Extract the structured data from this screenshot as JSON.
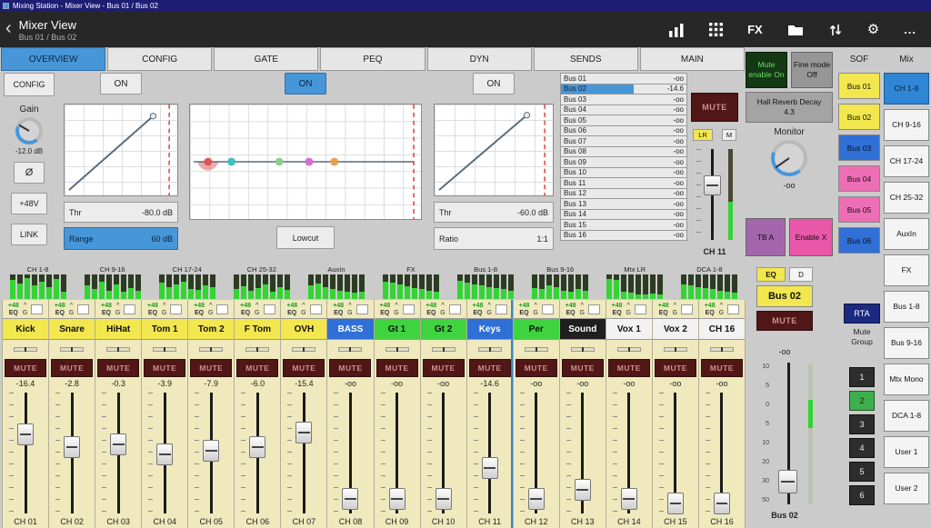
{
  "titlebar": {
    "text": "Mixing Station - Mixer View - Bus 01 / Bus 02"
  },
  "appbar": {
    "back": "‹",
    "title": "Mixer View",
    "subtitle": "Bus 01 / Bus 02",
    "fx": "FX",
    "gear": "⚙",
    "overflow": "..."
  },
  "tabs": [
    {
      "label": "OVERVIEW",
      "active": true
    },
    {
      "label": "CONFIG",
      "active": false
    },
    {
      "label": "GATE",
      "active": false
    },
    {
      "label": "PEQ",
      "active": false
    },
    {
      "label": "DYN",
      "active": false
    },
    {
      "label": "SENDS",
      "active": false
    },
    {
      "label": "MAIN",
      "active": false
    }
  ],
  "config": {
    "button": "CONFIG",
    "gain_label": "Gain",
    "gain_value": "-12.0 dB",
    "phase": "Ø",
    "phantom": "+48V",
    "link": "LINK"
  },
  "gate": {
    "on": "ON",
    "thr_label": "Thr",
    "thr_value": "-80.0 dB",
    "range_label": "Range",
    "range_value": "60 dB"
  },
  "peq": {
    "on": "ON",
    "lowcut": "Lowcut",
    "band_colors": [
      "#e05555",
      "#3fbfbf",
      "#8fcf8f",
      "#d36fd3",
      "#e8a050"
    ]
  },
  "dyn": {
    "on": "ON",
    "thr_label": "Thr",
    "thr_value": "-60.0 dB",
    "ratio_label": "Ratio",
    "ratio_value": "1:1"
  },
  "sends": {
    "rows": [
      {
        "name": "Bus 01",
        "value": "-oo",
        "fill_pct": 0
      },
      {
        "name": "Bus 02",
        "value": "-14.6",
        "fill_pct": 58
      },
      {
        "name": "Bus 03",
        "value": "-oo",
        "fill_pct": 0
      },
      {
        "name": "Bus 04",
        "value": "-oo",
        "fill_pct": 0
      },
      {
        "name": "Bus 05",
        "value": "-oo",
        "fill_pct": 0
      },
      {
        "name": "Bus 06",
        "value": "-oo",
        "fill_pct": 0
      },
      {
        "name": "Bus 07",
        "value": "-oo",
        "fill_pct": 0
      },
      {
        "name": "Bus 08",
        "value": "-oo",
        "fill_pct": 0
      },
      {
        "name": "Bus 09",
        "value": "-oo",
        "fill_pct": 0
      },
      {
        "name": "Bus 10",
        "value": "-oo",
        "fill_pct": 0
      },
      {
        "name": "Bus 11",
        "value": "-oo",
        "fill_pct": 0
      },
      {
        "name": "Bus 12",
        "value": "-oo",
        "fill_pct": 0
      },
      {
        "name": "Bus 13",
        "value": "-oo",
        "fill_pct": 0
      },
      {
        "name": "Bus 14",
        "value": "-oo",
        "fill_pct": 0
      },
      {
        "name": "Bus 15",
        "value": "-oo",
        "fill_pct": 0
      },
      {
        "name": "Bus 16",
        "value": "-oo",
        "fill_pct": 0
      }
    ]
  },
  "selected_channel": {
    "mute": "MUTE",
    "lr": "LR",
    "mono": "M",
    "name": "CH 11",
    "fader_pct": 41
  },
  "monitor_panel": {
    "mute_enable": "Mute enable On",
    "fine_mode": "Fine mode Off",
    "effect_name": "Hall Reverb Decay",
    "effect_value": "4.3",
    "monitor_label": "Monitor",
    "monitor_value": "-oo",
    "talkback": "TB A",
    "enable_x": "Enable X"
  },
  "output_strip": {
    "eq": "EQ",
    "d": "D",
    "name": "Bus 02",
    "mute": "MUTE",
    "value": "-oo",
    "bottom": "Bus 02",
    "fader_pct": 83,
    "scale": [
      "10",
      "5",
      "0",
      "5",
      "10",
      "20",
      "30",
      "50"
    ]
  },
  "rta": "RTA",
  "mute_group": {
    "label": "Mute Group",
    "buttons": [
      "1",
      "2",
      "3",
      "4",
      "5",
      "6"
    ],
    "active": "2"
  },
  "sof": {
    "header": "SOF",
    "buttons": [
      {
        "label": "Bus 01",
        "color": "yellow"
      },
      {
        "label": "Bus 02",
        "color": "yellow"
      },
      {
        "label": "Bus 03",
        "color": "blue"
      },
      {
        "label": "Bus 04",
        "color": "pink"
      },
      {
        "label": "Bus 05",
        "color": "pink"
      },
      {
        "label": "Bus 06",
        "color": "blue"
      }
    ]
  },
  "mix": {
    "header": "Mix",
    "buttons": [
      {
        "label": "CH 1-8",
        "active": true
      },
      {
        "label": "CH 9-16",
        "active": false
      },
      {
        "label": "CH 17-24",
        "active": false
      },
      {
        "label": "CH 25-32",
        "active": false
      },
      {
        "label": "AuxIn",
        "active": false
      },
      {
        "label": "FX",
        "active": false
      },
      {
        "label": "Bus 1-8",
        "active": false
      },
      {
        "label": "Bus 9-16",
        "active": false
      },
      {
        "label": "Mtx Mono",
        "active": false
      },
      {
        "label": "DCA 1-8",
        "active": false
      },
      {
        "label": "User 1",
        "active": false
      },
      {
        "label": "User 2",
        "active": false
      }
    ]
  },
  "meter_bridge": [
    {
      "label": "CH 1-8",
      "levels": [
        78,
        62,
        85,
        55,
        70,
        48,
        80,
        30
      ]
    },
    {
      "label": "CH 9-16",
      "levels": [
        55,
        40,
        72,
        35,
        60,
        28,
        45,
        32
      ]
    },
    {
      "label": "CH 17-24",
      "levels": [
        65,
        50,
        58,
        70,
        42,
        38,
        55,
        48
      ]
    },
    {
      "label": "CH 25-32",
      "levels": [
        40,
        52,
        35,
        45,
        58,
        30,
        48,
        36
      ]
    },
    {
      "label": "AuxIn",
      "levels": [
        55,
        62,
        48,
        40,
        35,
        30,
        25,
        28
      ]
    },
    {
      "label": "FX",
      "levels": [
        70,
        65,
        58,
        52,
        45,
        40,
        35,
        30
      ]
    },
    {
      "label": "Bus 1-8",
      "levels": [
        75,
        68,
        60,
        55,
        50,
        45,
        40,
        35
      ]
    },
    {
      "label": "Bus 9-16",
      "levels": [
        45,
        40,
        55,
        50,
        35,
        30,
        40,
        32
      ]
    },
    {
      "label": "Mtx LR",
      "levels": [
        80,
        78,
        30,
        25,
        20,
        18,
        22,
        20
      ]
    },
    {
      "label": "DCA 1-8",
      "levels": [
        60,
        55,
        50,
        45,
        40,
        35,
        30,
        25
      ]
    }
  ],
  "strip_header": {
    "phantom": "+48",
    "eq": "EQ",
    "pan": "^",
    "gate": "G"
  },
  "labels": {
    "mute": "MUTE"
  },
  "strips": [
    {
      "name": "Kick",
      "color": "yellow",
      "db": "-16.4",
      "fader_pct": 35,
      "ch": "CH 01",
      "selected": false
    },
    {
      "name": "Snare",
      "color": "yellow",
      "db": "-2.8",
      "fader_pct": 45,
      "ch": "CH 02",
      "selected": false
    },
    {
      "name": "HiHat",
      "color": "yellow",
      "db": "-0.3",
      "fader_pct": 43,
      "ch": "CH 03",
      "selected": false
    },
    {
      "name": "Tom 1",
      "color": "yellow",
      "db": "-3.9",
      "fader_pct": 51,
      "ch": "CH 04",
      "selected": false
    },
    {
      "name": "Tom 2",
      "color": "yellow",
      "db": "-7.9",
      "fader_pct": 48,
      "ch": "CH 05",
      "selected": false
    },
    {
      "name": "F Tom",
      "color": "yellow",
      "db": "-6.0",
      "fader_pct": 45,
      "ch": "CH 06",
      "selected": false
    },
    {
      "name": "OVH",
      "color": "yellow",
      "db": "-15.4",
      "fader_pct": 34,
      "ch": "CH 07",
      "selected": false
    },
    {
      "name": "BASS",
      "color": "blue",
      "db": "-oo",
      "fader_pct": 86,
      "ch": "CH 08",
      "selected": false
    },
    {
      "name": "Gt 1",
      "color": "green",
      "db": "-oo",
      "fader_pct": 86,
      "ch": "CH 09",
      "selected": false
    },
    {
      "name": "Gt 2",
      "color": "green",
      "db": "-oo",
      "fader_pct": 86,
      "ch": "CH 10",
      "selected": false
    },
    {
      "name": "Keys",
      "color": "blue",
      "db": "-14.6",
      "fader_pct": 62,
      "ch": "CH 11",
      "selected": true
    },
    {
      "name": "Per",
      "color": "green",
      "db": "-oo",
      "fader_pct": 86,
      "ch": "CH 12",
      "selected": false
    },
    {
      "name": "Sound",
      "color": "dark",
      "db": "-oo",
      "fader_pct": 79,
      "ch": "CH 13",
      "selected": false
    },
    {
      "name": "Vox 1",
      "color": "white",
      "db": "-oo",
      "fader_pct": 86,
      "ch": "CH 14",
      "selected": false
    },
    {
      "name": "Vox 2",
      "color": "white",
      "db": "-oo",
      "fader_pct": 90,
      "ch": "CH 15",
      "selected": false
    },
    {
      "name": "CH 16",
      "color": "white",
      "db": "-oo",
      "fader_pct": 90,
      "ch": "CH 16",
      "selected": false
    }
  ],
  "colors": {
    "yellow": "#f2e74e",
    "green": "#3fd43f",
    "blue": "#2f6fd6",
    "dark": "#1f1f1f",
    "white": "#f2f2f2",
    "pink": "#ee6eb6",
    "accent": "#4796d8",
    "meter": "#35d435",
    "mute_bg": "#511616",
    "mute_text": "#cf8f8f"
  }
}
